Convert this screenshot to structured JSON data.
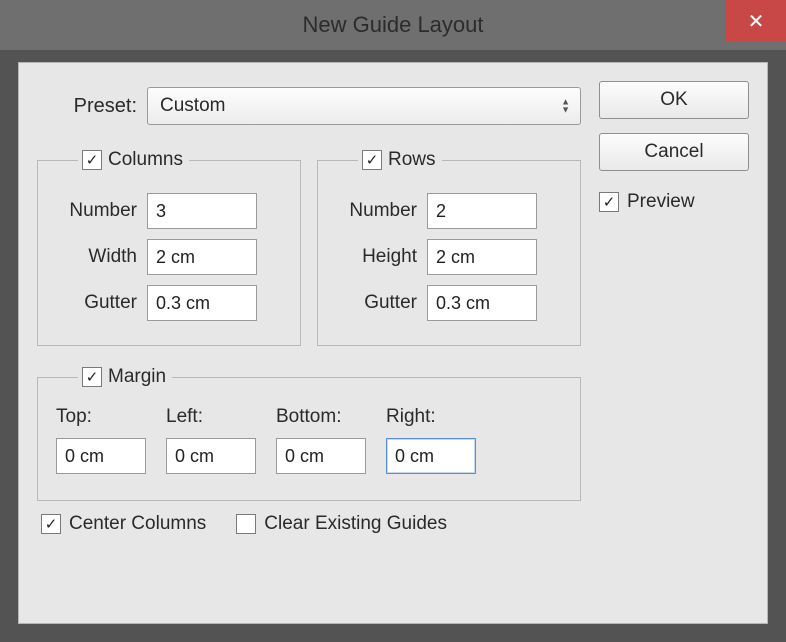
{
  "title": "New Guide Layout",
  "close_glyph": "✕",
  "buttons": {
    "ok": "OK",
    "cancel": "Cancel"
  },
  "preview": {
    "label": "Preview",
    "checked_glyph": "✓"
  },
  "preset": {
    "label": "Preset:",
    "value": "Custom"
  },
  "columns": {
    "title": "Columns",
    "checked_glyph": "✓",
    "number_label": "Number",
    "number_value": "3",
    "width_label": "Width",
    "width_value": "2 cm",
    "gutter_label": "Gutter",
    "gutter_value": "0.3 cm"
  },
  "rows": {
    "title": "Rows",
    "checked_glyph": "✓",
    "number_label": "Number",
    "number_value": "2",
    "height_label": "Height",
    "height_value": "2 cm",
    "gutter_label": "Gutter",
    "gutter_value": "0.3 cm"
  },
  "margin": {
    "title": "Margin",
    "checked_glyph": "✓",
    "top_label": "Top:",
    "top_value": "0 cm",
    "left_label": "Left:",
    "left_value": "0 cm",
    "bottom_label": "Bottom:",
    "bottom_value": "0 cm",
    "right_label": "Right:",
    "right_value": "0 cm"
  },
  "center_columns": {
    "label": "Center Columns",
    "checked_glyph": "✓"
  },
  "clear_guides": {
    "label": "Clear Existing Guides",
    "checked_glyph": ""
  }
}
